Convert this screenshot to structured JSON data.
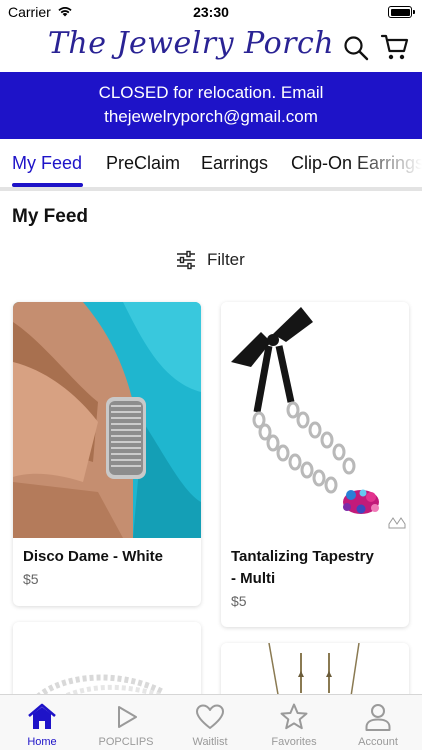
{
  "status_bar": {
    "carrier": "Carrier",
    "time": "23:30"
  },
  "header": {
    "logo": "The Jewelry Porch",
    "icons": [
      "search-icon",
      "cart-icon"
    ]
  },
  "banner": {
    "line1": "CLOSED for relocation.  Email",
    "line2": "thejewelryporch@gmail.com"
  },
  "tabs": [
    {
      "label": "My Feed",
      "active": true
    },
    {
      "label": "PreClaim",
      "active": false
    },
    {
      "label": "Earrings",
      "active": false
    },
    {
      "label": "Clip-On Earrings",
      "active": false
    }
  ],
  "feed": {
    "title": "My Feed",
    "filter_label": "Filter",
    "products": [
      {
        "name": "Disco Dame - White",
        "price": "$5"
      },
      {
        "name_line1": "Tantalizing Tapestry",
        "name_line2": "- Multi",
        "price": "$5"
      }
    ]
  },
  "tabbar": {
    "items": [
      {
        "label": "Home",
        "icon": "home-icon",
        "active": true
      },
      {
        "label": "POPCLIPS",
        "icon": "play-icon",
        "active": false
      },
      {
        "label": "Waitlist",
        "icon": "heart-icon",
        "active": false
      },
      {
        "label": "Favorites",
        "icon": "star-icon",
        "active": false
      },
      {
        "label": "Account",
        "icon": "person-icon",
        "active": false
      }
    ]
  },
  "colors": {
    "brand": "#1e13c8",
    "logo": "#2a2394",
    "inactive": "#9a9a9a"
  }
}
